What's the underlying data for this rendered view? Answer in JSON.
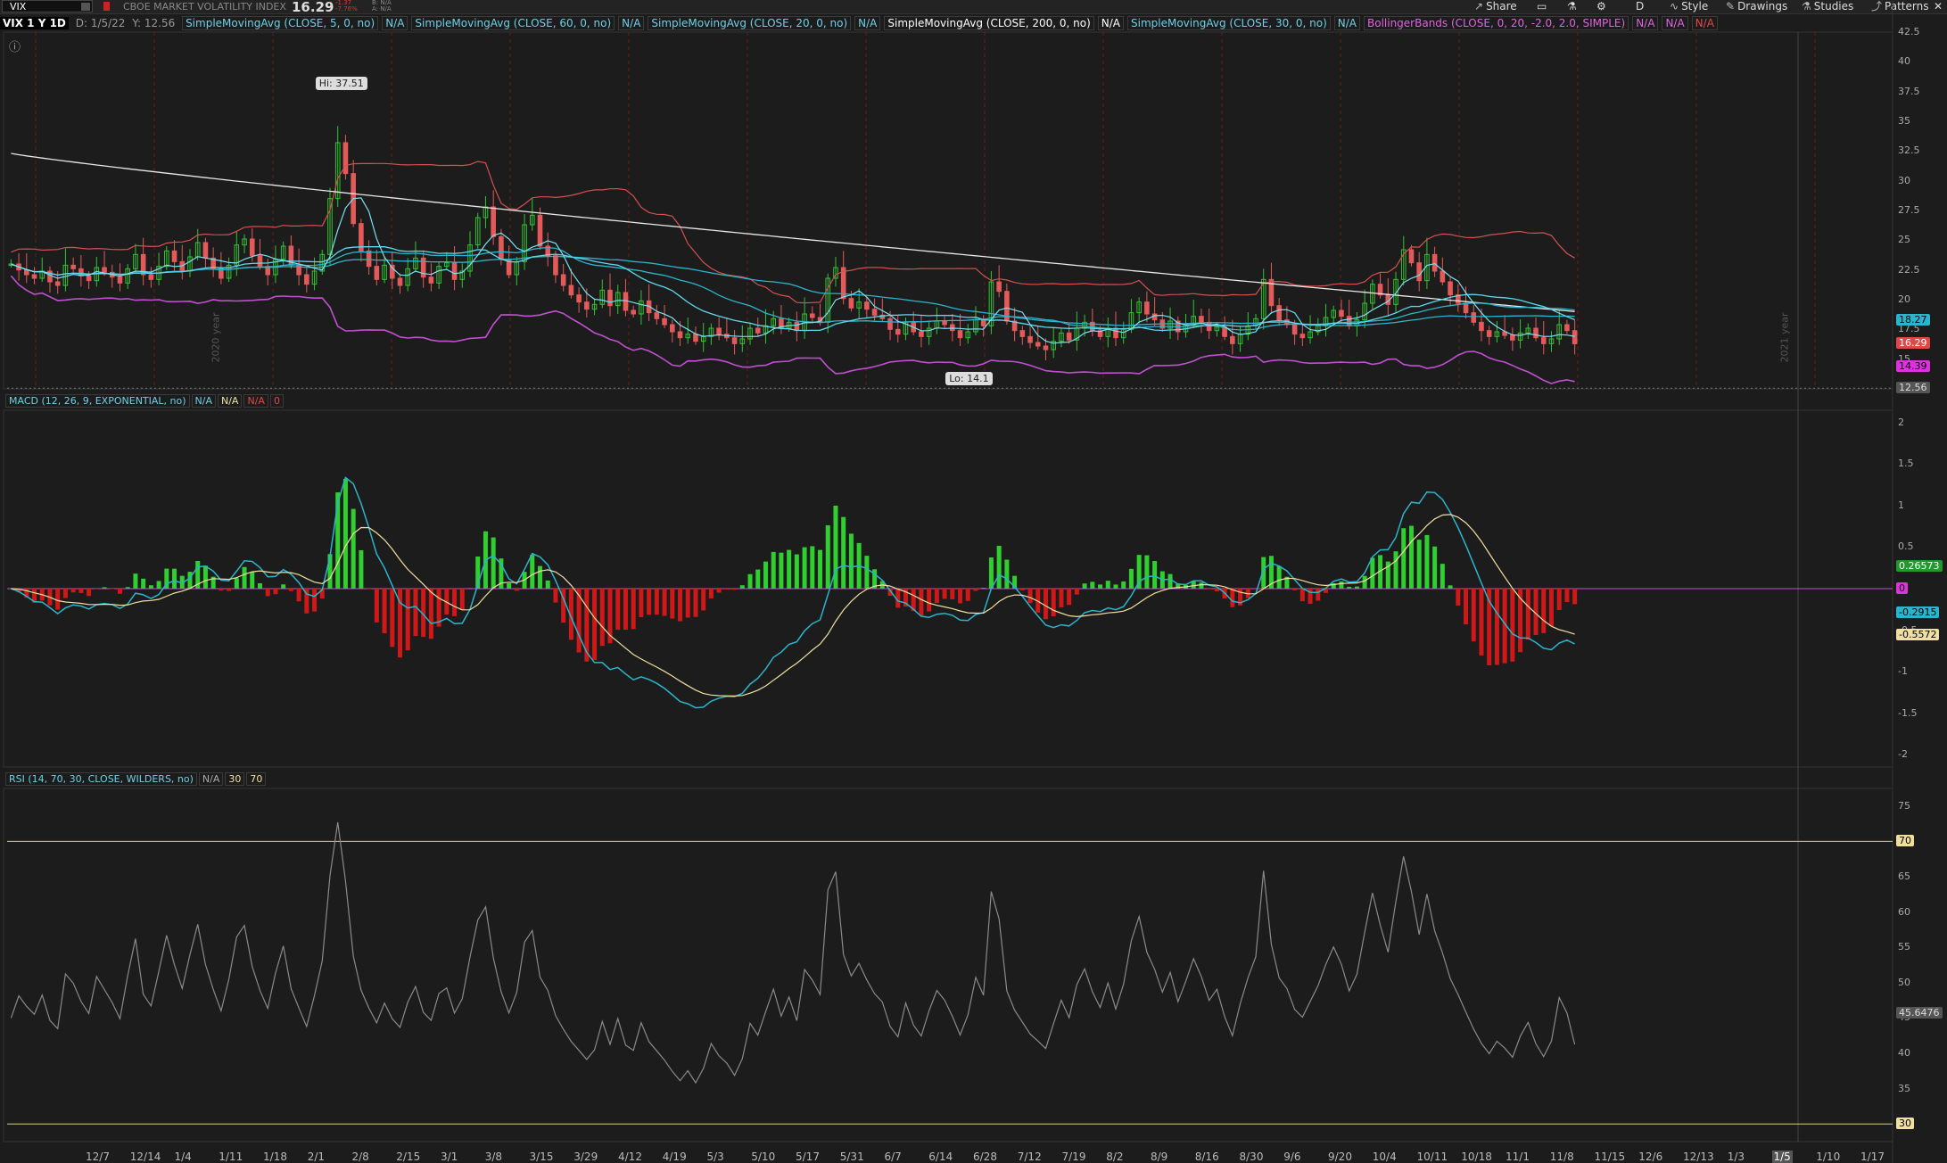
{
  "toolbar": {
    "symbol": "VIX",
    "description": "CBOE MARKET VOLATILITY INDEX",
    "last": "16.29",
    "change": "-1.37",
    "change_pct": "-7.76%",
    "bid": "B: N/A",
    "ask": "A: N/A",
    "share_label": "Share",
    "style_label": "Style",
    "drawings_label": "Drawings",
    "studies_label": "Studies",
    "patterns_label": "Patterns",
    "aggregation": "D"
  },
  "study_row": {
    "symbol_period": "VIX 1 Y 1D",
    "date_stamp": "D: 1/5/22",
    "y_stamp": "Y: 12.56",
    "studies": [
      {
        "label": "SimpleMovingAvg (CLOSE, 5, 0, no)",
        "value": "N/A",
        "color": "#6fd0e6"
      },
      {
        "label": "SimpleMovingAvg (CLOSE, 60, 0, no)",
        "value": "N/A",
        "color": "#6fd0e6"
      },
      {
        "label": "SimpleMovingAvg (CLOSE, 20, 0, no)",
        "value": "N/A",
        "color": "#6fd0e6"
      },
      {
        "label": "SimpleMovingAvg (CLOSE, 200, 0, no)",
        "value": "N/A",
        "color": "#ffffff"
      },
      {
        "label": "SimpleMovingAvg (CLOSE, 30, 0, no)",
        "value": "N/A",
        "color": "#6fd0e6"
      },
      {
        "label": "BollingerBands (CLOSE, 0, 20, -2.0, 2.0, SIMPLE)",
        "value": "N/A",
        "color": "#dd66dd"
      }
    ],
    "extra_values": [
      {
        "text": "N/A",
        "color": "#dd66dd"
      },
      {
        "text": "N/A",
        "color": "#e04848"
      }
    ]
  },
  "price_panel": {
    "hi_label": "Hi: 37.51",
    "lo_label": "Lo: 14.1",
    "axis_ticks": [
      "42.5",
      "40",
      "37.5",
      "35",
      "32.5",
      "30",
      "27.5",
      "25",
      "22.5",
      "20",
      "17.5",
      "15",
      "12.5"
    ],
    "tags": [
      {
        "text": "18.27",
        "bg": "#2bb5cc",
        "fg": "#000"
      },
      {
        "text": "16.29",
        "bg": "#e04848",
        "fg": "#fff"
      },
      {
        "text": "14.39",
        "bg": "#dd33dd",
        "fg": "#000"
      },
      {
        "text": "12.56",
        "bg": "#555555",
        "fg": "#ddd"
      }
    ],
    "year_labels": [
      "2020 year",
      "2021 year"
    ]
  },
  "macd_panel": {
    "header": "MACD (12, 26, 9, EXPONENTIAL, no)",
    "values": [
      {
        "text": "N/A",
        "color": "#6fd0e6"
      },
      {
        "text": "N/A",
        "color": "#f0e0a0"
      },
      {
        "text": "N/A",
        "color": "#e04848"
      },
      {
        "text": "0",
        "color": "#e04848"
      }
    ],
    "axis_ticks": [
      "2",
      "1.5",
      "1",
      "0.5",
      "0",
      "-0.5",
      "-1",
      "-1.5",
      "-2"
    ],
    "tags": [
      {
        "text": "0.26573",
        "bg": "#1f9a2a",
        "fg": "#fff"
      },
      {
        "text": "0",
        "bg": "#dd33dd",
        "fg": "#000"
      },
      {
        "text": "-0.2915",
        "bg": "#2bb5cc",
        "fg": "#000"
      },
      {
        "text": "-0.5572",
        "bg": "#f0e0a0",
        "fg": "#000"
      }
    ]
  },
  "rsi_panel": {
    "header": "RSI (14, 70, 30, CLOSE, WILDERS, no)",
    "values": [
      {
        "text": "N/A",
        "color": "#aaaaaa"
      },
      {
        "text": "30",
        "color": "#f0e0a0"
      },
      {
        "text": "70",
        "color": "#f0e0a0"
      }
    ],
    "axis_ticks": [
      "75",
      "70",
      "65",
      "60",
      "55",
      "50",
      "45",
      "40",
      "35",
      "30"
    ],
    "tags": [
      {
        "text": "70",
        "bg": "#f0e0a0",
        "fg": "#000"
      },
      {
        "text": "45.6476",
        "bg": "#555555",
        "fg": "#ddd"
      },
      {
        "text": "30",
        "bg": "#f0e0a0",
        "fg": "#000"
      }
    ]
  },
  "x_axis": [
    "12/7",
    "12/14",
    "1/4",
    "1/11",
    "1/18",
    "2/1",
    "2/8",
    "2/15",
    "3/1",
    "3/8",
    "3/15",
    "3/29",
    "4/12",
    "4/19",
    "5/3",
    "5/10",
    "5/17",
    "5/31",
    "6/7",
    "6/14",
    "6/28",
    "7/12",
    "7/19",
    "8/2",
    "8/9",
    "8/16",
    "8/30",
    "9/6",
    "9/20",
    "10/4",
    "10/11",
    "10/18",
    "11/1",
    "11/8",
    "11/15",
    "12/6",
    "12/13",
    "1/3",
    "1/5",
    "1/10",
    "1/17"
  ],
  "x_axis_highlight": "1/5",
  "chart_data": {
    "type": "candlestick",
    "symbol": "VIX",
    "interval": "1D",
    "range": "1 Y",
    "price_ylim": [
      12.5,
      42.5
    ],
    "high": 37.51,
    "low": 14.1,
    "last": 16.29,
    "close_series": [
      23.0,
      22.5,
      22.1,
      21.8,
      22.4,
      21.5,
      21.2,
      22.9,
      22.6,
      22.0,
      21.6,
      22.7,
      22.3,
      21.9,
      21.4,
      22.6,
      23.8,
      22.1,
      21.7,
      22.8,
      24.1,
      23.2,
      22.4,
      23.6,
      24.8,
      23.5,
      22.6,
      21.8,
      22.9,
      24.6,
      25.1,
      23.7,
      22.8,
      22.1,
      23.4,
      24.5,
      22.9,
      22.1,
      21.3,
      22.4,
      23.8,
      28.5,
      33.2,
      30.6,
      26.4,
      24.1,
      22.8,
      21.7,
      22.9,
      21.8,
      21.2,
      22.6,
      23.5,
      21.9,
      21.4,
      22.8,
      23.1,
      21.7,
      22.4,
      24.6,
      26.9,
      27.8,
      25.3,
      23.4,
      22.1,
      23.2,
      26.3,
      27.1,
      24.5,
      23.7,
      22.1,
      21.2,
      20.4,
      19.8,
      19.2,
      19.6,
      20.8,
      19.5,
      20.6,
      19.1,
      18.8,
      19.9,
      18.9,
      18.4,
      17.9,
      17.3,
      16.8,
      17.1,
      16.5,
      16.9,
      17.6,
      17.1,
      16.8,
      16.3,
      16.7,
      17.6,
      17.2,
      17.8,
      18.4,
      17.6,
      18.1,
      17.4,
      18.8,
      18.5,
      18.1,
      21.8,
      22.7,
      20.1,
      19.3,
      19.8,
      19.2,
      18.7,
      18.4,
      17.5,
      17.1,
      18.1,
      17.3,
      16.9,
      17.6,
      18.2,
      17.9,
      17.4,
      16.8,
      17.3,
      18.3,
      17.8,
      21.5,
      20.7,
      18.2,
      17.4,
      16.9,
      16.4,
      16.1,
      15.8,
      16.5,
      17.2,
      16.6,
      17.6,
      18.1,
      17.4,
      16.9,
      17.6,
      16.8,
      17.5,
      18.9,
      19.8,
      18.8,
      18.3,
      17.6,
      18.2,
      17.3,
      17.9,
      18.6,
      18.1,
      17.4,
      17.7,
      16.9,
      16.3,
      17.1,
      17.8,
      18.4,
      21.7,
      19.5,
      18.3,
      17.9,
      17.1,
      16.8,
      17.3,
      17.8,
      18.5,
      19.1,
      18.6,
      17.8,
      18.3,
      19.7,
      21.3,
      20.4,
      19.6,
      21.7,
      24.2,
      23.1,
      21.6,
      23.8,
      22.4,
      21.5,
      20.4,
      19.7,
      18.9,
      18.1,
      17.4,
      16.9,
      17.3,
      17.0,
      16.6,
      17.2,
      17.6,
      16.8,
      16.3,
      16.7,
      17.9,
      17.4,
      16.29
    ]
  }
}
